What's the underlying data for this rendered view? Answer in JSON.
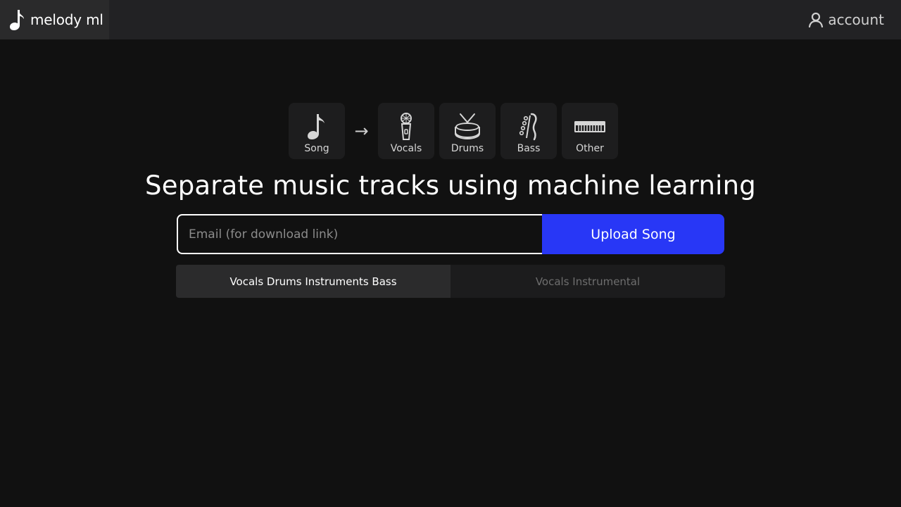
{
  "header": {
    "brand_label": "melody ml",
    "brand_icon": "music-note-icon",
    "account_label": "account",
    "account_icon": "user-icon"
  },
  "steps": {
    "source": {
      "label": "Song",
      "icon": "music-note-icon"
    },
    "arrow": "→",
    "outputs": [
      {
        "label": "Vocals",
        "icon": "microphone-icon"
      },
      {
        "label": "Drums",
        "icon": "drum-icon"
      },
      {
        "label": "Bass",
        "icon": "bass-guitar-icon"
      },
      {
        "label": "Other",
        "icon": "keyboard-icon"
      }
    ]
  },
  "main": {
    "headline": "Separate music tracks using machine learning",
    "email_placeholder": "Email (for download link)",
    "email_value": "",
    "upload_label": "Upload Song",
    "modes": [
      {
        "label": "Vocals Drums Instruments Bass",
        "selected": true
      },
      {
        "label": "Vocals Instrumental",
        "selected": false
      }
    ]
  },
  "colors": {
    "background": "#111111",
    "topbar": "#222224",
    "accent": "#2837f6"
  }
}
